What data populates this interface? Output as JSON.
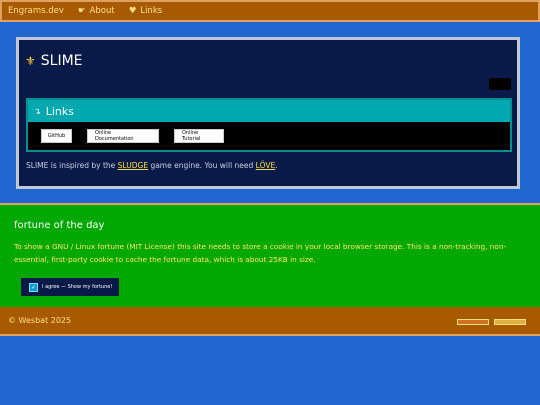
{
  "nav": {
    "brand": "Engrams.dev",
    "items": [
      {
        "icon": "pointing-hand-icon",
        "label": "About"
      },
      {
        "icon": "heart-icon",
        "label": "Links"
      }
    ]
  },
  "main": {
    "title": "SLIME",
    "links_panel": {
      "header": "Links",
      "buttons": [
        "GitHub",
        "Online Documentation",
        "Online Tutorial"
      ]
    },
    "inspired": {
      "prefix": "SLIME is inspired by the ",
      "engine_link": "SLUDGE",
      "middle": " game engine. You will need ",
      "love_link": "LÖVE",
      "suffix": "."
    }
  },
  "fortune": {
    "title": "fortune of the day",
    "description": "To show a GNU / Linux fortune (MIT License) this site needs to store a cookie in your local browser storage. This is a non-tracking, non-essential, first-party cookie to cache the fortune data, which is about 25KB in size.",
    "agree_label": "I agree — Show my fortune!"
  },
  "footer": {
    "copyright": "© Wesbat 2025",
    "badges": [
      "",
      ""
    ]
  },
  "colors": {
    "background": "#1f66d1",
    "nav": "#a85a00",
    "card": "#0a1a48",
    "links_header": "#00a8b0",
    "fortune": "#00a800",
    "link": "#ffe040"
  }
}
